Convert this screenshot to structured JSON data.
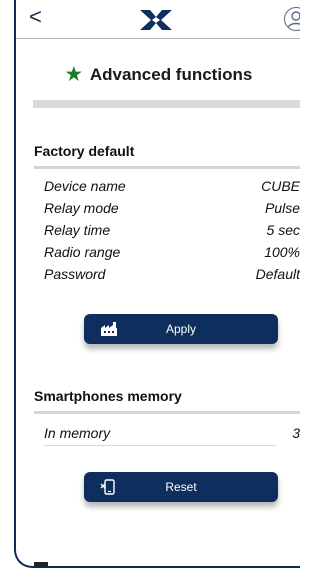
{
  "header": {
    "back_label": "<",
    "logo_icon": "cross-logo-icon",
    "profile_icon": "user-avatar-icon"
  },
  "page": {
    "title": "Advanced functions",
    "title_icon": "star-icon",
    "accent_color": "#1c7a2c",
    "primary_color": "#0e2f5e"
  },
  "factory_default": {
    "heading": "Factory default",
    "rows": [
      {
        "label": "Device name",
        "value": "CUBE"
      },
      {
        "label": "Relay mode",
        "value": "Pulse"
      },
      {
        "label": "Relay time",
        "value": "5 sec"
      },
      {
        "label": "Radio range",
        "value": "100%"
      },
      {
        "label": "Password",
        "value": "Default"
      }
    ],
    "apply_label": "Apply",
    "apply_icon": "factory-icon"
  },
  "smartphones_memory": {
    "heading": "Smartphones memory",
    "in_memory_label": "In memory",
    "in_memory_value": "3",
    "reset_label": "Reset",
    "reset_icon": "phone-remove-icon"
  }
}
